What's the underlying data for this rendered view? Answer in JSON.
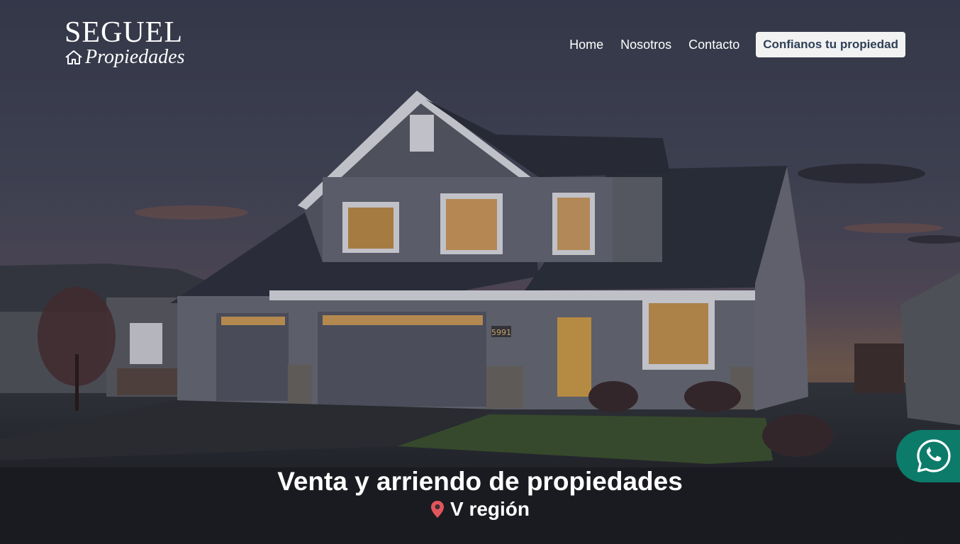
{
  "logo": {
    "brand": "SEGUEL",
    "tagline": "Propiedades",
    "icon": "house-outline-icon"
  },
  "nav": {
    "items": [
      "Home",
      "Nosotros",
      "Contacto"
    ],
    "cta_label": "Confianos tu propiedad"
  },
  "hero": {
    "title": "Venta y arriendo de propiedades",
    "location": "V región",
    "location_icon": "map-pin-icon",
    "house_number": "5991"
  },
  "whatsapp": {
    "icon": "whatsapp-icon",
    "color": "#0d7b6a"
  },
  "colors": {
    "pin": "#e2555c",
    "cta_text": "#2f4157"
  }
}
